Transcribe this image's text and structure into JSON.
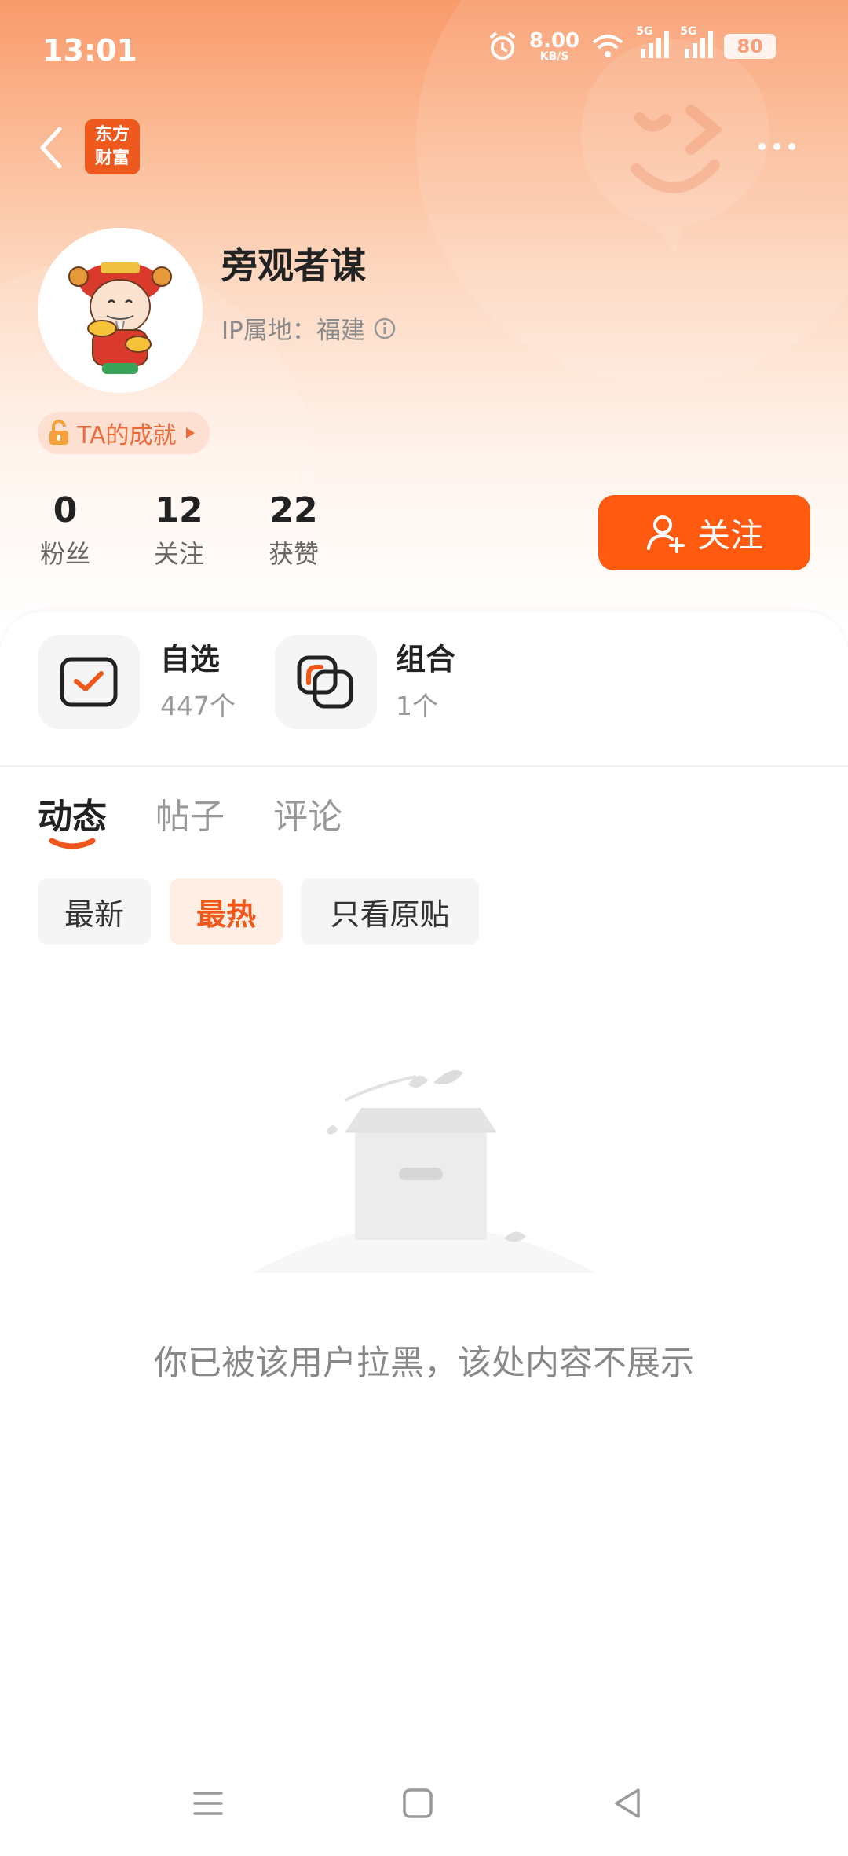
{
  "status_bar": {
    "time": "13:01",
    "net_speed_value": "8.00",
    "net_speed_unit": "KB/S",
    "sim1": "5G",
    "sim2": "5G",
    "battery": "80"
  },
  "header": {
    "logo_line1": "东方",
    "logo_line2": "财富"
  },
  "profile": {
    "name": "旁观者谋",
    "ip_location": "IP属地：福建",
    "achievement_label": "TA的成就"
  },
  "stats": [
    {
      "value": "0",
      "label": "粉丝"
    },
    {
      "value": "12",
      "label": "关注"
    },
    {
      "value": "22",
      "label": "获赞"
    }
  ],
  "follow_button": {
    "label": "关注"
  },
  "cards": [
    {
      "title": "自选",
      "count": "447个"
    },
    {
      "title": "组合",
      "count": "1个"
    }
  ],
  "tabs": [
    {
      "label": "动态",
      "active": true
    },
    {
      "label": "帖子",
      "active": false
    },
    {
      "label": "评论",
      "active": false
    }
  ],
  "filters": [
    {
      "label": "最新",
      "active": false
    },
    {
      "label": "最热",
      "active": true
    },
    {
      "label": "只看原贴",
      "active": false
    }
  ],
  "empty_state": {
    "message": "你已被该用户拉黑，该处内容不展示"
  },
  "colors": {
    "accent": "#ff5a10",
    "accent_soft": "#feeee4",
    "header_gradient_top": "#f99a6a"
  }
}
